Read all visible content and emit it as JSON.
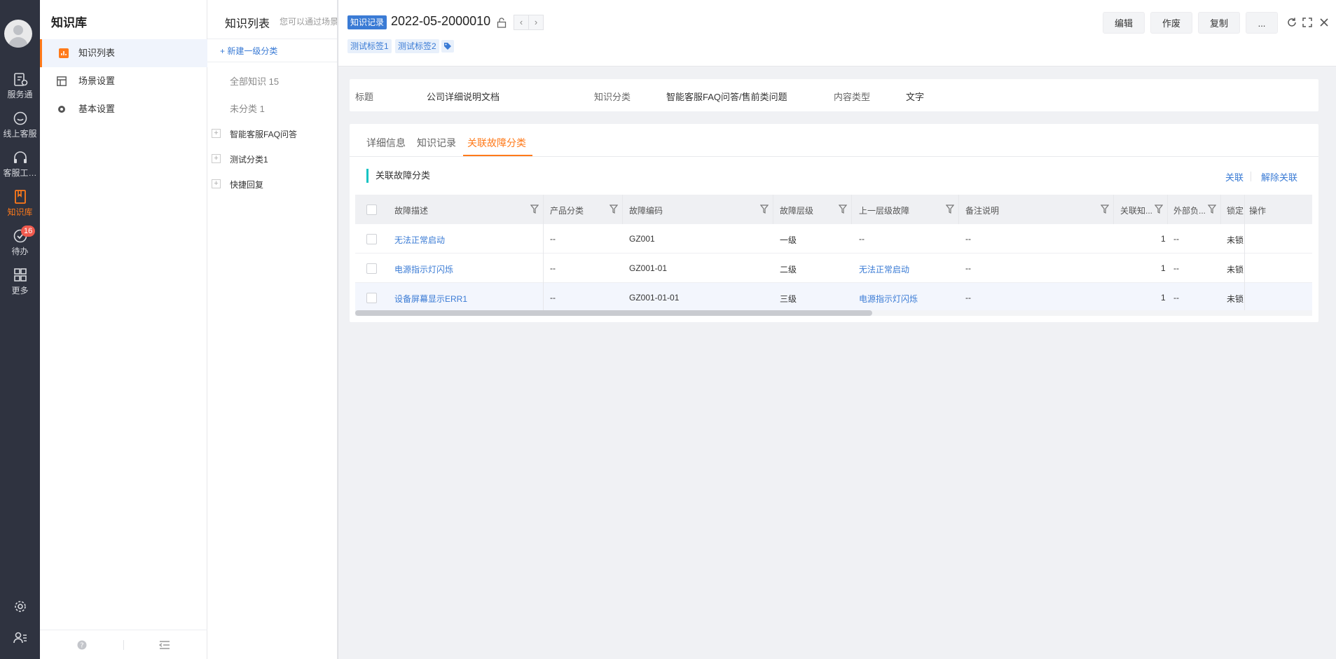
{
  "rail": {
    "items": [
      {
        "label": "服务通",
        "icon": "clipboard-edit-icon"
      },
      {
        "label": "线上客服",
        "icon": "chat-smile-icon"
      },
      {
        "label": "客服工…",
        "icon": "headset-icon"
      },
      {
        "label": "知识库",
        "icon": "book-icon",
        "active": true
      },
      {
        "label": "待办",
        "icon": "check-circle-icon",
        "badge": "16"
      },
      {
        "label": "更多",
        "icon": "grid-icon"
      }
    ]
  },
  "kb": {
    "title": "知识库",
    "menu": [
      {
        "label": "知识列表",
        "icon": "chart-icon"
      },
      {
        "label": "场景设置",
        "icon": "layout-icon"
      },
      {
        "label": "基本设置",
        "icon": "gear-icon"
      }
    ]
  },
  "list": {
    "title": "知识列表",
    "subtitle": "您可以通过场景",
    "new_category": "+ 新建一级分类",
    "all": "全部知识 15",
    "uncategorized": "未分类 1",
    "tree": [
      "智能客服FAQ问答",
      "测试分类1",
      "快捷回复"
    ]
  },
  "detail": {
    "type_tag": "知识记录",
    "record_no": "2022-05-2000010",
    "tags": [
      "测试标签1",
      "测试标签2"
    ],
    "buttons": {
      "edit": "编辑",
      "void": "作废",
      "copy": "复制",
      "more": "..."
    },
    "info": {
      "title_key": "标题",
      "title_val": "公司详细说明文档",
      "cat_key": "知识分类",
      "cat_val": "智能客服FAQ问答/售前类问题",
      "type_key": "内容类型",
      "type_val": "文字"
    },
    "tabs": [
      "详细信息",
      "知识记录",
      "关联故障分类"
    ],
    "section_title": "关联故障分类",
    "actions": {
      "link": "关联",
      "unlink": "解除关联"
    },
    "table": {
      "headers": [
        "故障描述",
        "产品分类",
        "故障编码",
        "故障层级",
        "上一层级故障",
        "备注说明",
        "关联知...",
        "外部负...",
        "锁定",
        "操作"
      ],
      "rows": [
        {
          "desc": "无法正常启动",
          "product": "--",
          "code": "GZ001",
          "level": "一级",
          "parent": "--",
          "remark": "--",
          "linked": "1",
          "ext": "--",
          "lock": "未锁"
        },
        {
          "desc": "电源指示灯闪烁",
          "product": "--",
          "code": "GZ001-01",
          "level": "二级",
          "parent": "无法正常启动",
          "remark": "--",
          "linked": "1",
          "ext": "--",
          "lock": "未锁"
        },
        {
          "desc": "设备屏幕显示ERR1",
          "product": "--",
          "code": "GZ001-01-01",
          "level": "三级",
          "parent": "电源指示灯闪烁",
          "remark": "--",
          "linked": "1",
          "ext": "--",
          "lock": "未锁"
        }
      ]
    }
  }
}
